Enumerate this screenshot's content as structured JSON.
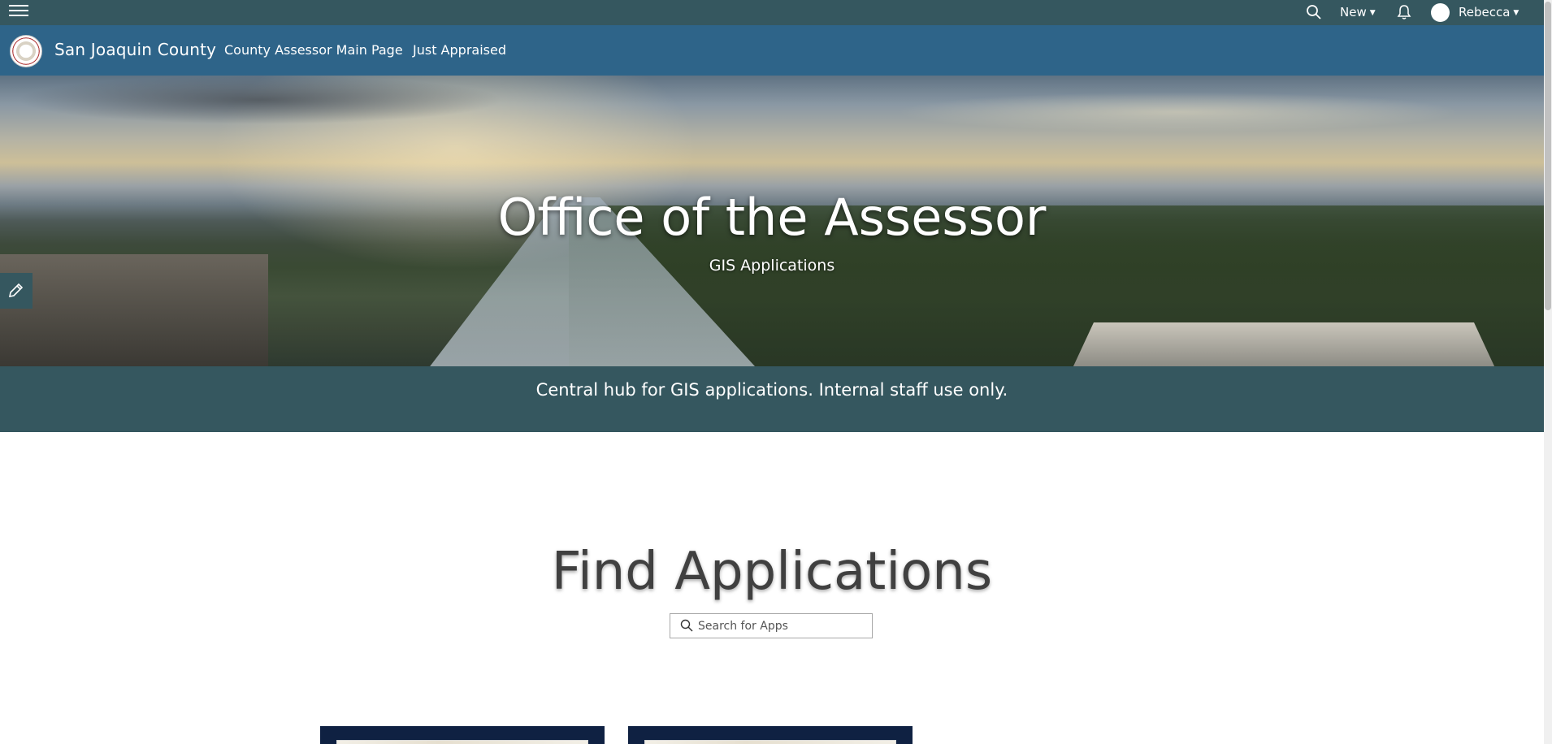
{
  "topbar": {
    "menu_icon": "hamburger-menu-icon",
    "search_icon": "search-icon",
    "new_label": "New",
    "notifications_icon": "bell-icon",
    "user_name": "Rebecca"
  },
  "header": {
    "site_title": "San Joaquin County",
    "nav": [
      {
        "label": "County Assessor Main Page"
      },
      {
        "label": "Just Appraised"
      }
    ]
  },
  "hero": {
    "title": "Office of the Assessor",
    "subtitle": "GIS Applications",
    "edit_icon": "pencil-icon"
  },
  "tagline": {
    "text": "Central hub for GIS applications. Internal staff use only."
  },
  "find": {
    "title": "Find Applications",
    "search_placeholder": "Search for Apps"
  },
  "colors": {
    "topbar": "#35575f",
    "header": "#2e6489",
    "card": "#0f2142"
  }
}
